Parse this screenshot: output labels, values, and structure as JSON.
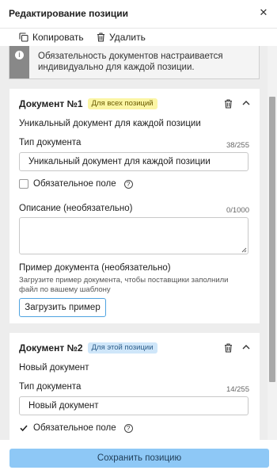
{
  "header": {
    "title": "Редактирование позиции",
    "close_icon": "close-icon"
  },
  "toolbar": {
    "copy_label": "Копировать",
    "delete_label": "Удалить"
  },
  "info": {
    "text": "Обязательность документов настраивается индивидуально для каждой позиции."
  },
  "documents": [
    {
      "title": "Документ №1",
      "badge": "Для всех позиций",
      "badge_color": "#fbf5a4",
      "subtitle": "Уникальный документ для каждой позиции",
      "type_label": "Тип документа",
      "type_counter": "38/255",
      "type_value": "Уникальный документ для каждой позиции",
      "required_label": "Обязательное поле",
      "required": false,
      "desc_label": "Описание (необязательно)",
      "desc_counter": "0/1000",
      "desc_value": "",
      "example_label": "Пример документа (необязательно)",
      "example_hint": "Загрузите пример документа, чтобы поставщики заполнили файл по вашему шаблону",
      "upload_label": "Загрузить пример"
    },
    {
      "title": "Документ №2",
      "badge": "Для этой позиции",
      "badge_color": "#cfe6f9",
      "subtitle": "Новый документ",
      "type_label": "Тип документа",
      "type_counter": "14/255",
      "type_value": "Новый документ",
      "required_label": "Обязательное поле",
      "required": true
    }
  ],
  "footer": {
    "save_label": "Сохранить позицию",
    "accent": "#8ec8f6"
  }
}
